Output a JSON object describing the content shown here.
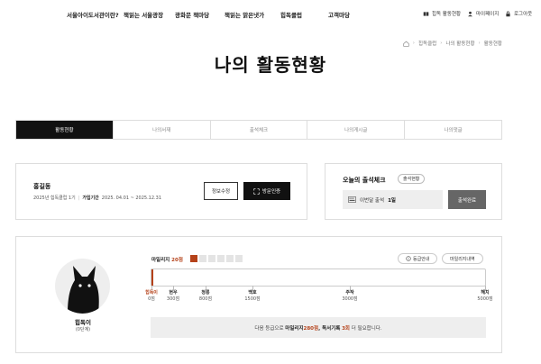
{
  "nav": {
    "menu": [
      "서울아이도서관이란?",
      "책읽는 서울광장",
      "광화문 책마당",
      "책읽는 맑은냇가",
      "힙독클럽",
      "고객마당"
    ],
    "util": {
      "hipdok": "힙독 활동현황",
      "mypage": "마이페이지",
      "logout": "로그아웃"
    }
  },
  "breadcrumb": [
    "힙독클럽",
    "나의 활동현황",
    "활동현황"
  ],
  "page_title": "나의 활동현황",
  "tabs": [
    "활동현황",
    "나의서재",
    "출석체크",
    "나의게시글",
    "나의댓글"
  ],
  "profile": {
    "name": "홍길동",
    "member": "2025년 힙독클럽 1기",
    "period_label": "가입기간",
    "period": "2025. 04.01 ~ 2025.12.31",
    "edit_button": "정보수정",
    "visit_button": "방문인증"
  },
  "attendance": {
    "title": "오늘의 출석체크",
    "status_button": "출석현황",
    "count_prefix": "이번달 출석",
    "count_value": "1일",
    "complete_button": "출석완료"
  },
  "level": {
    "name": "힙독이",
    "sub": "(0단계)",
    "mileage_label": "마일리지",
    "mileage_value": "20점",
    "blocks_total": 6,
    "blocks_on": 1,
    "grade_info_button": "등급안내",
    "mileage_history_button": "마일리지내역",
    "progress_percent": 0.6,
    "stages": [
      {
        "name": "힙독이",
        "points": "0점",
        "current": true
      },
      {
        "name": "현우",
        "points": "300점",
        "current": false
      },
      {
        "name": "청룡",
        "points": "800점",
        "current": false
      },
      {
        "name": "백호",
        "points": "1500점",
        "current": false
      },
      {
        "name": "주작",
        "points": "3000점",
        "current": false
      },
      {
        "name": "해치",
        "points": "5000점",
        "current": false
      }
    ],
    "note": {
      "prefix": "다음 등급으로",
      "mileage_label": "마일리지",
      "mileage_value": "280점",
      "read_label": ", 독서기록",
      "read_value": "3회",
      "suffix": "더 필요합니다."
    }
  },
  "colors": {
    "accent": "#b5421a",
    "dark": "#111111"
  }
}
